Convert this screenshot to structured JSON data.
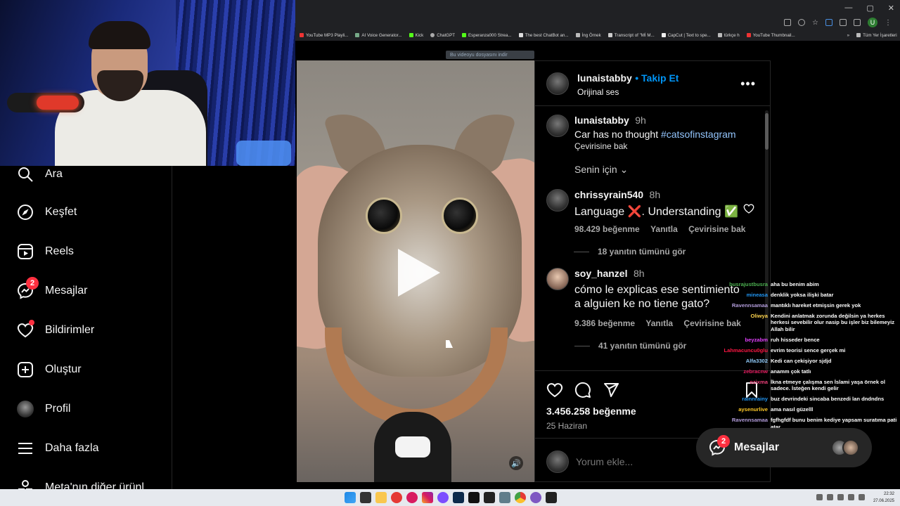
{
  "browser": {
    "window_controls": [
      "—",
      "▢",
      "✕"
    ],
    "bookmarks": [
      "YouTube MP3 Playli...",
      "AI Voice Generator...",
      "Kick",
      "ChatGPT",
      "Esperanza000 Strea...",
      "The best ChatBot an...",
      "İng Örnek",
      "Transcript of \"Mİ M...",
      "CapCut | Text to spe...",
      "türkçe h",
      "YouTube Thumbnail..."
    ],
    "all_bookmarks": "Tüm Yer İşaretleri",
    "profile_initial": "U",
    "download_bar": "Bu videoyu dosyasını indir"
  },
  "nav": {
    "items": [
      {
        "label": "Ara",
        "icon": "search-icon"
      },
      {
        "label": "Keşfet",
        "icon": "compass-icon"
      },
      {
        "label": "Reels",
        "icon": "reels-icon"
      },
      {
        "label": "Mesajlar",
        "icon": "messenger-icon",
        "badge": "2"
      },
      {
        "label": "Bildirimler",
        "icon": "heart-icon"
      },
      {
        "label": "Oluştur",
        "icon": "plus-square-icon"
      },
      {
        "label": "Profil",
        "icon": "avatar"
      },
      {
        "label": "Daha fazla",
        "icon": "menu-icon"
      },
      {
        "label": "Meta'nın diğer ürünl",
        "icon": "apps-icon"
      }
    ]
  },
  "post": {
    "author": "lunaistabby",
    "follow": "• Takip Et",
    "audio": "Orijinal ses",
    "more": "•••",
    "caption_author": "lunaistabby",
    "caption_time": "9h",
    "caption_text": "Car has no thought",
    "caption_tag": "#catsofinstagram",
    "translate": "Çevirisine bak",
    "for_you": "Senin için",
    "comments": [
      {
        "user": "chrissyrain540",
        "time": "8h",
        "text": "Language ❌. Understanding ✅",
        "likes": "98.429 beğenme",
        "reply": "Yanıtla",
        "translate": "Çevirisine bak",
        "view_replies": "18 yanıtın tümünü gör"
      },
      {
        "user": "soy_hanzel",
        "time": "8h",
        "text": "cómo le explicas ese sentimiento a alguien ke no tiene gato?",
        "likes": "9.386 beğenme",
        "reply": "Yanıtla",
        "translate": "Çevirisine bak",
        "view_replies": "41 yanıtın tümünü gör"
      }
    ],
    "like_count": "3.456.258 beğenme",
    "date": "25 Haziran",
    "comment_placeholder": "Yorum ekle..."
  },
  "chat": [
    {
      "user": "busrajustbusra",
      "color": "#4caf50",
      "msg": "aha bu benim abim"
    },
    {
      "user": "mineasa",
      "color": "#2196f3",
      "msg": "denklik yoksa ilişki batar"
    },
    {
      "user": "Ravennsamaa",
      "color": "#b39ddb",
      "msg": "mantıklı hareket etmişsin gerek yok"
    },
    {
      "user": "Oliwya",
      "color": "#ffd54f",
      "msg": "Kendini anlatmak zorunda değilsin ya herkes herkesi sevebilir olur nasip bu işler biz bilemeyiz Allah bilir"
    },
    {
      "user": "beyzabm",
      "color": "#e040fb",
      "msg": "ruh hisseder bence"
    },
    {
      "user": "Lahmacuncu0glu",
      "color": "#ff1744",
      "msg": "evrim teorisi sence gerçek mi"
    },
    {
      "user": "Alfa3302",
      "color": "#90caf9",
      "msg": "Kedi can çekişiyor sjdjd"
    },
    {
      "user": "zebracnw",
      "color": "#e91e63",
      "msg": "anamm çok tatlı"
    },
    {
      "user": "ozixma",
      "color": "#ec407a",
      "msg": "İkna etmeye çalışma sen İslami yaşa örnek ol sadece. İsteğen kendi gelir"
    },
    {
      "user": "rainnrainy",
      "color": "#2196f3",
      "msg": "buz devrindeki sincaba benzedi lan dndndns"
    },
    {
      "user": "aysenurlive",
      "color": "#ffca28",
      "msg": "ama nasıl güzelll"
    },
    {
      "user": "Ravennsamaa",
      "color": "#b39ddb",
      "msg": "fgfhgfdf bunu benim kediye yapsam suratıma pati atar"
    }
  ],
  "messages_pill": {
    "label": "Mesajlar",
    "badge": "2"
  },
  "taskbar": {
    "time": "22:32",
    "date": "27.06.2025"
  }
}
